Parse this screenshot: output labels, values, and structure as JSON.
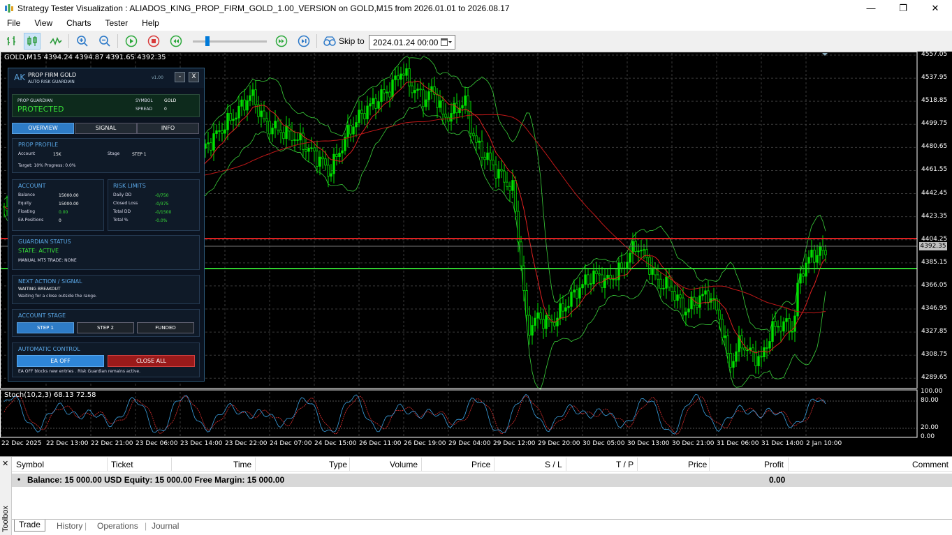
{
  "window": {
    "title": "Strategy Tester Visualization : ALIADOS_KING_PROP_FIRM_GOLD_1.00_VERSION on GOLD,M15 from 2026.01.01 to 2026.08.17",
    "minimize": "—",
    "maximize": "❐",
    "close": "✕"
  },
  "menu": [
    "File",
    "View",
    "Charts",
    "Tester",
    "Help"
  ],
  "toolbar": {
    "skip_label": "Skip to",
    "skip_value": "2024.01.24 00:00",
    "slider_position": 0.17,
    "icons": [
      "bar-chart-icon",
      "candlestick-icon",
      "line-chart-icon",
      "zoom-in-icon",
      "zoom-out-icon",
      "play-icon",
      "stop-icon",
      "rewind-icon",
      "fast-forward-icon",
      "skip-end-icon",
      "skip-to-icon"
    ]
  },
  "chart": {
    "header": "GOLD,M15  4394.24 4394.87 4391.65 4392.35",
    "current_price": "4392.35",
    "price_labels": [
      "4557.05",
      "4537.95",
      "4518.85",
      "4499.75",
      "4480.65",
      "4461.55",
      "4442.45",
      "4423.35",
      "4404.25",
      "4385.15",
      "4366.05",
      "4346.95",
      "4327.85",
      "4308.75",
      "4289.65"
    ],
    "stoch_header": "Stoch(10,2,3) 68.13 72.58",
    "stoch_levels": [
      "100.00",
      "80.00",
      "20.00",
      "0.00"
    ],
    "time_labels": [
      "22 Dec 2025",
      "22 Dec 13:00",
      "22 Dec 21:00",
      "23 Dec 06:00",
      "23 Dec 14:00",
      "23 Dec 22:00",
      "24 Dec 07:00",
      "24 Dec 15:00",
      "26 Dec 11:00",
      "26 Dec 19:00",
      "29 Dec 04:00",
      "29 Dec 12:00",
      "29 Dec 20:00",
      "30 Dec 05:00",
      "30 Dec 13:00",
      "30 Dec 21:00",
      "31 Dec 06:00",
      "31 Dec 14:00",
      "2 Jan 10:00"
    ],
    "colors": {
      "background": "#000000",
      "candles": "#00e000",
      "ma_fast": "#e02020",
      "ma_slow": "#c01818",
      "bands": "#3ad13a",
      "resistance": "#e02020",
      "support": "#30d030",
      "stoch_main": "#3aa0e0",
      "stoch_signal": "#e03030"
    }
  },
  "panel": {
    "logo": "AK",
    "title": "PROP FIRM GOLD",
    "subtitle": "AUTO RISK GUARDIAN",
    "version": "v1.00",
    "minimize": "-",
    "close": "X",
    "guardian": {
      "label": "PROP GUARDIAN",
      "status": "PROTECTED",
      "symbol_label": "SYMBOL",
      "symbol_value": "GOLD",
      "spread_label": "SPREAD",
      "spread_value": "0"
    },
    "tabs": [
      "OVERVIEW",
      "SIGNAL",
      "INFO"
    ],
    "profile": {
      "header": "PROP PROFILE",
      "account_label": "Account",
      "account_value": "15K",
      "stage_label": "Stage",
      "stage_value": "STEP 1",
      "target_line": "Target: 10%  Progress: 0.0%"
    },
    "account": {
      "header": "ACCOUNT",
      "rows": [
        {
          "label": "Balance",
          "value": "15000.00"
        },
        {
          "label": "Equity",
          "value": "15000.00"
        },
        {
          "label": "Floating",
          "value": "0.00"
        },
        {
          "label": "EA Positions",
          "value": "0"
        }
      ]
    },
    "risk": {
      "header": "RISK LIMITS",
      "rows": [
        {
          "label": "Daily DD",
          "value": "-0/750"
        },
        {
          "label": "Closed Loss",
          "value": "-0/375"
        },
        {
          "label": "Total DD",
          "value": "-0/1500"
        },
        {
          "label": "Total %",
          "value": "-0.0%"
        }
      ]
    },
    "guardian_status": {
      "header": "GUARDIAN STATUS",
      "state": "STATE: ACTIVE",
      "manual": "MANUAL MT5 TRADE: NONE"
    },
    "next_action": {
      "header": "NEXT ACTION / SIGNAL",
      "title": "WAITING BREAKOUT",
      "desc": "Waiting for a close outside the range."
    },
    "stage": {
      "header": "ACCOUNT STAGE",
      "buttons": [
        "STEP 1",
        "STEP 2",
        "FUNDED"
      ]
    },
    "control": {
      "header": "AUTOMATIC CONTROL",
      "ea_button": "EA OFF",
      "close_button": "CLOSE ALL",
      "note": "EA OFF blocks new entries . Risk Guardian remains active."
    }
  },
  "terminal": {
    "toolbox_label": "Toolbox",
    "close": "✕",
    "columns": [
      "Symbol",
      "Ticket",
      "Time",
      "Type",
      "Volume",
      "Price",
      "S / L",
      "T / P",
      "Price",
      "Profit",
      "Comment"
    ],
    "balance_bullet": "•",
    "balance_text": "Balance: 15 000.00 USD  Equity: 15 000.00  Free Margin: 15 000.00",
    "balance_profit": "0.00",
    "tabs": [
      "Trade",
      "History",
      "Operations",
      "Journal"
    ]
  }
}
